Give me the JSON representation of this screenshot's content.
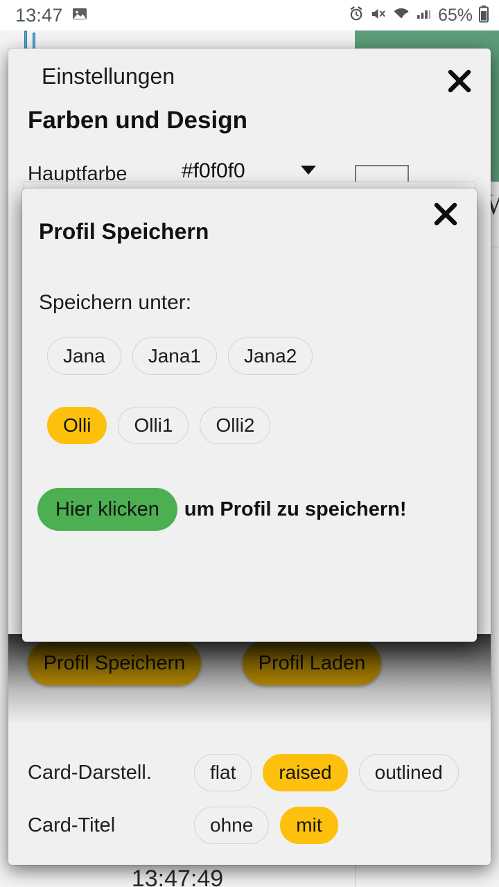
{
  "statusbar": {
    "time": "13:47",
    "battery_percent": "65%",
    "icons": [
      "image-icon",
      "alarm-icon",
      "mute-icon",
      "wifi-icon",
      "signal-icon",
      "battery-icon"
    ]
  },
  "background": {
    "clock": "13:47:49",
    "partial_letter": "W",
    "accent_green": "#5d9c78"
  },
  "settings_dialog": {
    "title": "Einstellungen",
    "close_label": "✕",
    "section_heading": "Farben und Design",
    "hauptfarbe": {
      "label": "Hauptfarbe",
      "value": "#f0f0f0"
    },
    "profile_buttons": {
      "save": "Profil Speichern",
      "load": "Profil Laden"
    },
    "options": [
      {
        "label": "Card-Darstell.",
        "choices": [
          "flat",
          "raised",
          "outlined"
        ],
        "selected": "raised"
      },
      {
        "label": "Card-Titel",
        "choices": [
          "ohne",
          "mit"
        ],
        "selected": "mit"
      }
    ]
  },
  "save_profile_dialog": {
    "title": "Profil Speichern",
    "close_label": "✕",
    "subtitle": "Speichern unter:",
    "slots_row1": [
      "Jana",
      "Jana1",
      "Jana2"
    ],
    "slots_row2": [
      "Olli",
      "Olli1",
      "Olli2"
    ],
    "selected_slot": "Olli",
    "action_chip": "Hier klicken",
    "action_hint": "um Profil zu speichern!"
  },
  "colors": {
    "selected_chip": "#fdc10d",
    "gold_button": "#e9ae00",
    "green_action": "#4caf52",
    "dialog_bg": "#f0f0f0"
  }
}
